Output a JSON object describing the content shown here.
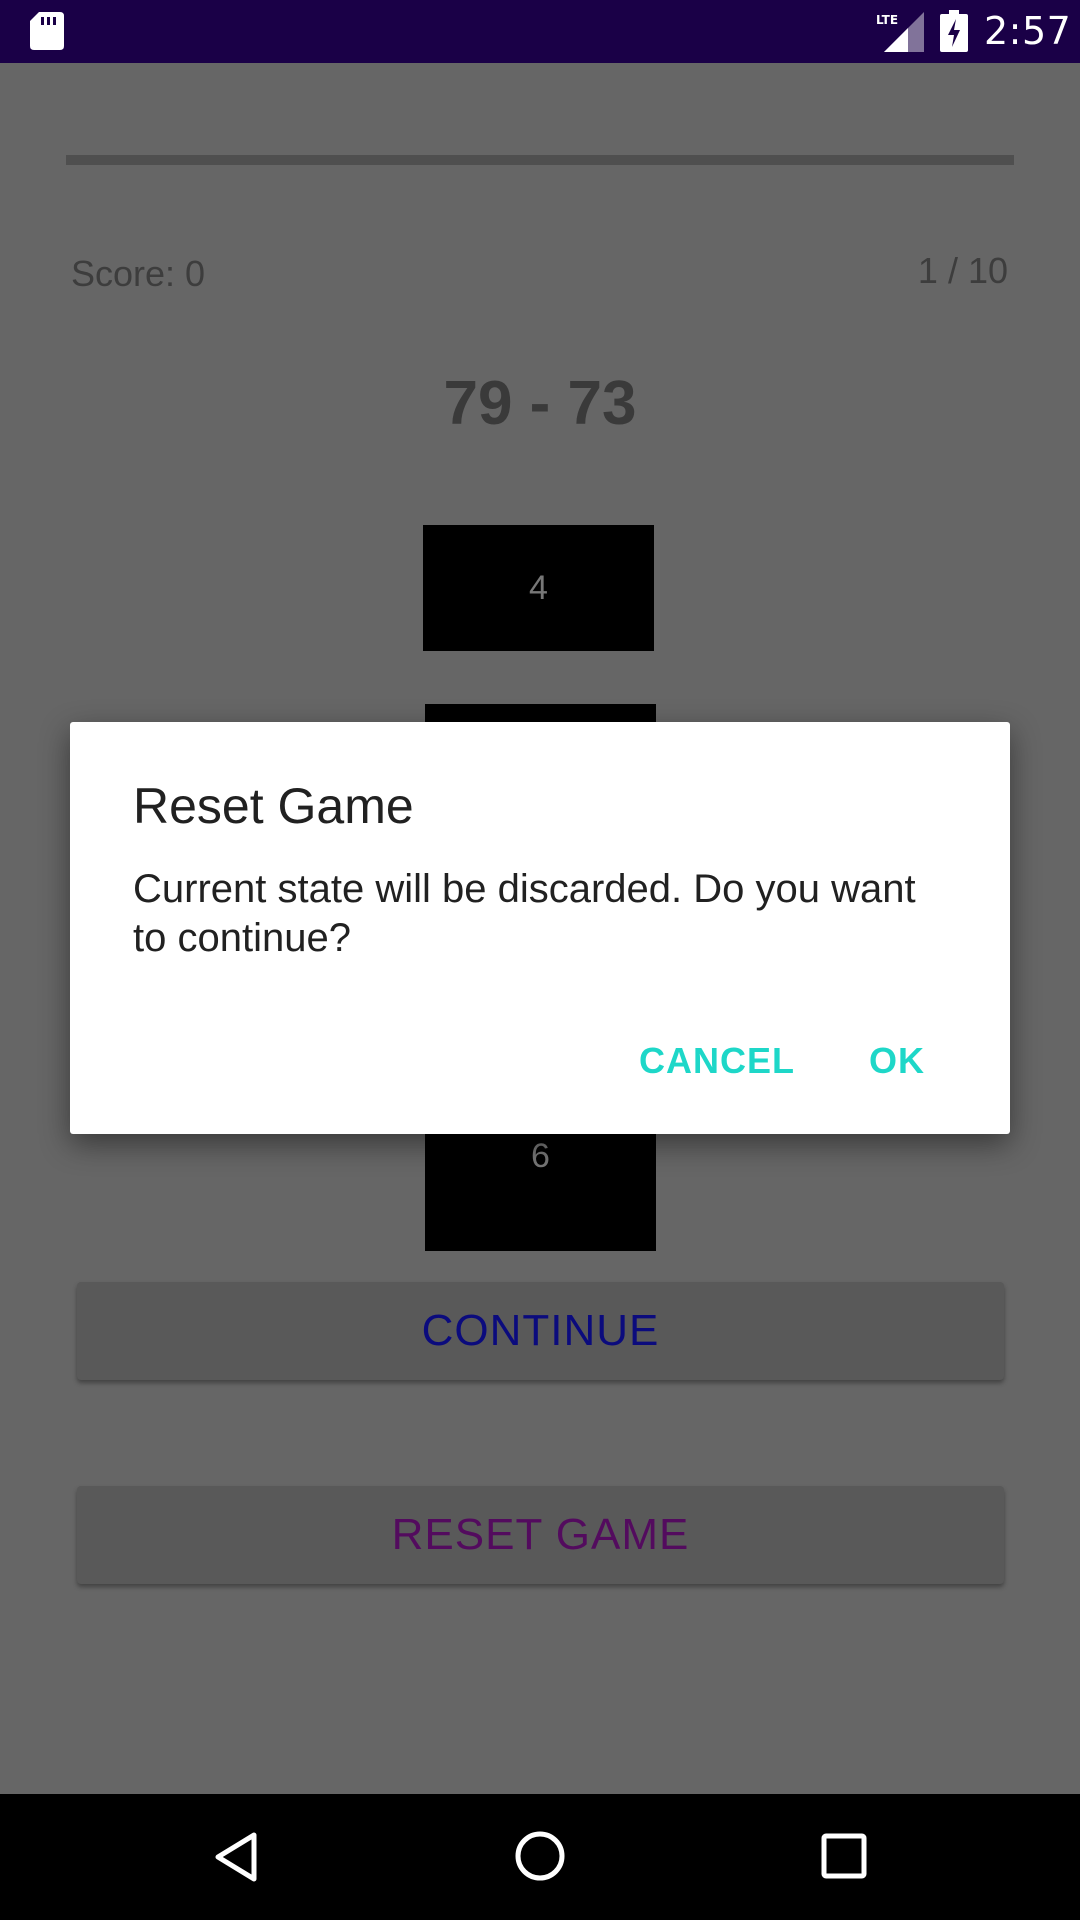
{
  "status_bar": {
    "time": "2:57",
    "network": "LTE",
    "icons": [
      "sd-card-icon",
      "lte-signal-icon",
      "battery-charging-icon"
    ]
  },
  "game": {
    "score_label": "Score: 0",
    "round_counter": "1 / 10",
    "question": "79 - 73",
    "answers": [
      "4",
      "",
      "",
      "6"
    ],
    "continue_label": "CONTINUE",
    "reset_label": "RESET GAME"
  },
  "dialog": {
    "title": "Reset Game",
    "message": "Current state will be discarded. Do you want to continue?",
    "cancel_label": "CANCEL",
    "ok_label": "OK"
  },
  "nav_bar": {
    "icons": [
      "back-icon",
      "home-icon",
      "recents-icon"
    ]
  },
  "colors": {
    "status_bar": "#1a0047",
    "scrim_background": "#666666",
    "dialog_accent": "#1ed7c8",
    "continue_text": "#0b0b7d",
    "reset_text": "#530b5e"
  }
}
